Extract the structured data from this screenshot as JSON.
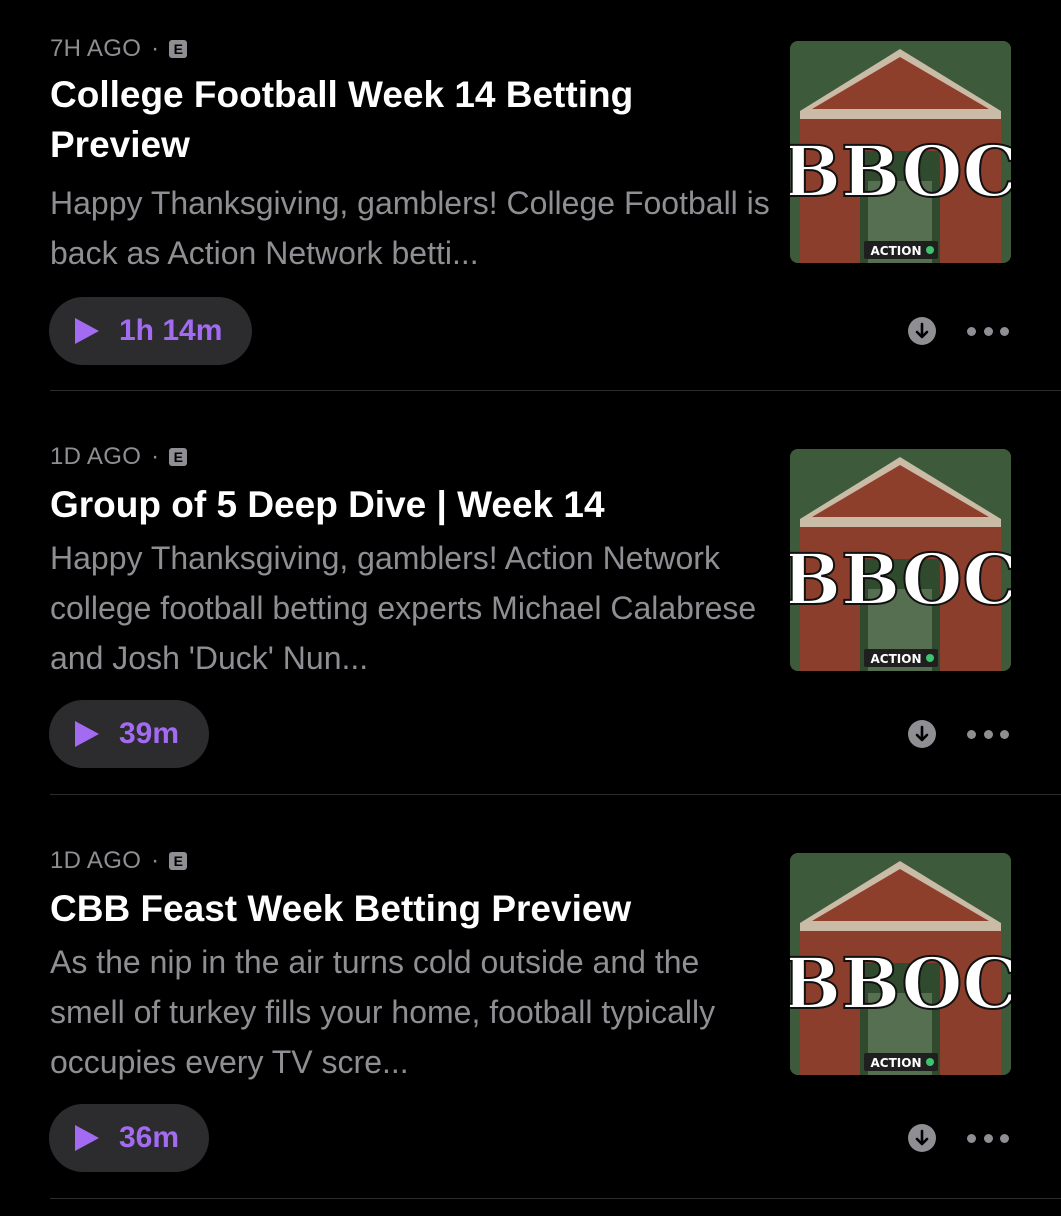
{
  "episodes": [
    {
      "age": "7H AGO",
      "explicit": "E",
      "title": "College Football Week 14 Betting Preview",
      "description": "Happy Thanksgiving, gamblers! College Football is back as Action Network betti...",
      "duration": "1h 14m",
      "artwork_text": "BBOC",
      "artwork_badge": "ACTION"
    },
    {
      "age": "1D AGO",
      "explicit": "E",
      "title": "Group of 5 Deep Dive | Week 14",
      "description": "Happy Thanksgiving, gamblers! Action Network college football betting experts Michael Calabrese and Josh 'Duck' Nun...",
      "duration": "39m",
      "artwork_text": "BBOC",
      "artwork_badge": "ACTION"
    },
    {
      "age": "1D AGO",
      "explicit": "E",
      "title": "CBB Feast Week Betting Preview",
      "description": "As the nip in the air turns cold outside and the smell of turkey fills your home, football typically occupies every TV scre...",
      "duration": "36m",
      "artwork_text": "BBOC",
      "artwork_badge": "ACTION"
    }
  ],
  "icons": {
    "play": "play-icon",
    "download": "download-icon",
    "more": "more-icon",
    "explicit": "explicit-badge"
  },
  "colors": {
    "accent": "#a36bf2",
    "secondary_text": "#8e8e93",
    "pill_background": "#2c2c2e"
  }
}
